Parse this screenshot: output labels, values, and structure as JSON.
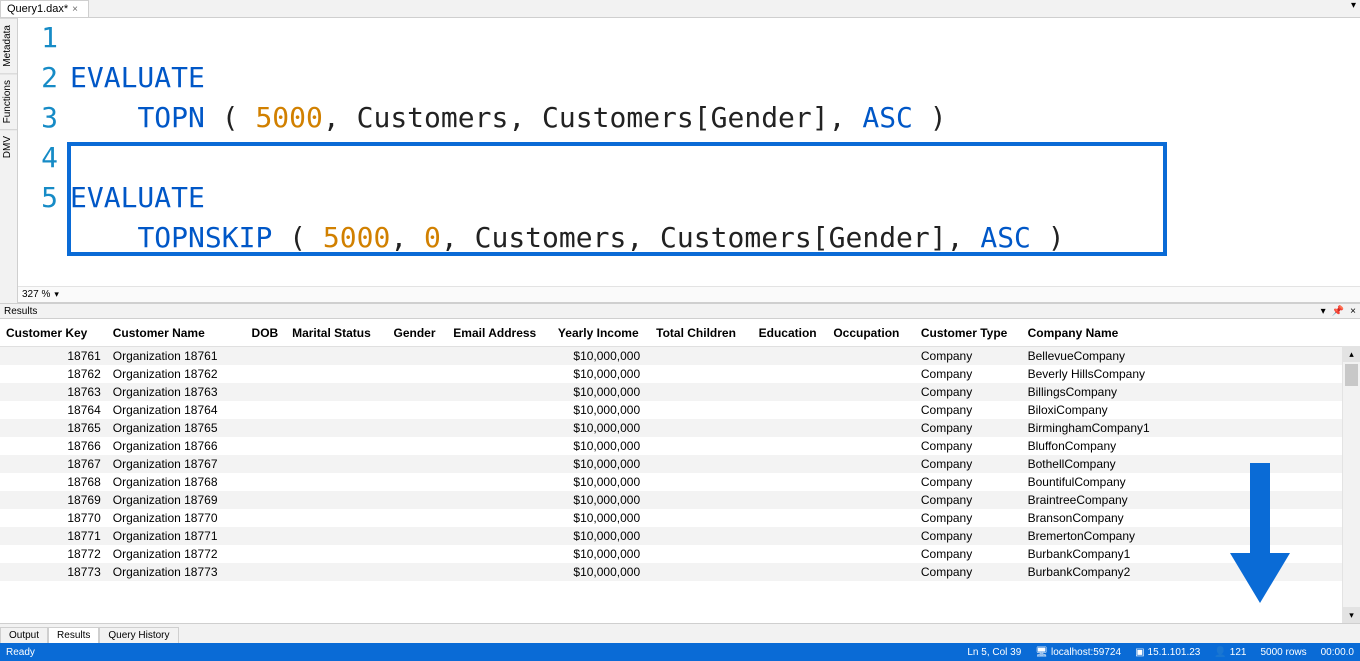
{
  "tabs": {
    "file": "Query1.dax*"
  },
  "side": {
    "metadata": "Metadata",
    "functions": "Functions",
    "dmv": "DMV"
  },
  "code": {
    "lines": [
      "1",
      "2",
      "3",
      "4",
      "5"
    ],
    "l1": {
      "kw": "EVALUATE"
    },
    "l2": {
      "fn": "TOPN",
      "open": " ( ",
      "n": "5000",
      "c1": ", ",
      "t": "Customers",
      "c2": ", ",
      "col": "Customers[Gender]",
      "c3": ", ",
      "sort": "ASC",
      "close": " )"
    },
    "l4": {
      "kw": "EVALUATE"
    },
    "l5": {
      "fn": "TOPNSKIP",
      "open": " ( ",
      "n": "5000",
      "c1": ", ",
      "skip": "0",
      "c2": ", ",
      "t": "Customers",
      "c3": ", ",
      "col": "Customers[Gender]",
      "c4": ", ",
      "sort": "ASC",
      "close": " )"
    }
  },
  "zoom": "327 %",
  "panel": {
    "title": "Results"
  },
  "columns": {
    "key": "Customer Key",
    "name": "Customer Name",
    "dob": "DOB",
    "marital": "Marital Status",
    "gender": "Gender",
    "email": "Email Address",
    "income": "Yearly Income",
    "children": "Total Children",
    "education": "Education",
    "occupation": "Occupation",
    "type": "Customer Type",
    "company": "Company Name"
  },
  "rows": [
    {
      "key": "18761",
      "name": "Organization 18761",
      "income": "$10,000,000",
      "type": "Company",
      "company": "BellevueCompany"
    },
    {
      "key": "18762",
      "name": "Organization 18762",
      "income": "$10,000,000",
      "type": "Company",
      "company": "Beverly HillsCompany"
    },
    {
      "key": "18763",
      "name": "Organization 18763",
      "income": "$10,000,000",
      "type": "Company",
      "company": "BillingsCompany"
    },
    {
      "key": "18764",
      "name": "Organization 18764",
      "income": "$10,000,000",
      "type": "Company",
      "company": "BiloxiCompany"
    },
    {
      "key": "18765",
      "name": "Organization 18765",
      "income": "$10,000,000",
      "type": "Company",
      "company": "BirminghamCompany1"
    },
    {
      "key": "18766",
      "name": "Organization 18766",
      "income": "$10,000,000",
      "type": "Company",
      "company": "BluffonCompany"
    },
    {
      "key": "18767",
      "name": "Organization 18767",
      "income": "$10,000,000",
      "type": "Company",
      "company": "BothellCompany"
    },
    {
      "key": "18768",
      "name": "Organization 18768",
      "income": "$10,000,000",
      "type": "Company",
      "company": "BountifulCompany"
    },
    {
      "key": "18769",
      "name": "Organization 18769",
      "income": "$10,000,000",
      "type": "Company",
      "company": "BraintreeCompany"
    },
    {
      "key": "18770",
      "name": "Organization 18770",
      "income": "$10,000,000",
      "type": "Company",
      "company": "BransonCompany"
    },
    {
      "key": "18771",
      "name": "Organization 18771",
      "income": "$10,000,000",
      "type": "Company",
      "company": "BremertonCompany"
    },
    {
      "key": "18772",
      "name": "Organization 18772",
      "income": "$10,000,000",
      "type": "Company",
      "company": "BurbankCompany1"
    },
    {
      "key": "18773",
      "name": "Organization 18773",
      "income": "$10,000,000",
      "type": "Company",
      "company": "BurbankCompany2"
    }
  ],
  "bottomtabs": {
    "output": "Output",
    "results": "Results",
    "history": "Query History"
  },
  "status": {
    "ready": "Ready",
    "pos": "Ln 5, Col 39",
    "server": "localhost:59724",
    "version": "15.1.101.23",
    "users": "121",
    "rows": "5000 rows",
    "time": "00:00.0"
  }
}
